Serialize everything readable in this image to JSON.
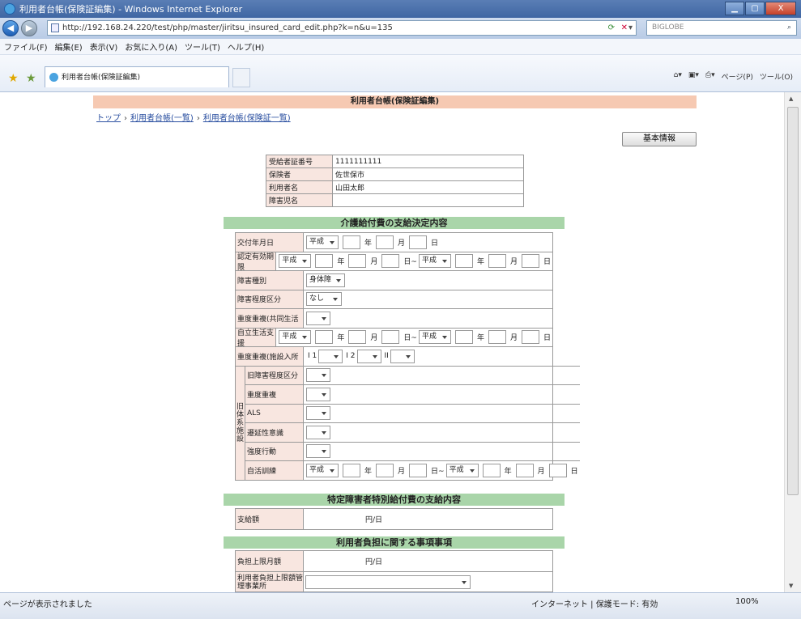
{
  "window": {
    "title": "利用者台帳(保険証編集) - Windows Internet Explorer",
    "btn_min": "▁",
    "btn_max": "▢",
    "btn_close": "X"
  },
  "address": {
    "url": "http://192.168.24.220/test/php/master/jiritsu_insured_card_edit.php?k=n&u=135",
    "search_placeholder": "BIGLOBE"
  },
  "menu": [
    "ファイル(F)",
    "編集(E)",
    "表示(V)",
    "お気に入り(A)",
    "ツール(T)",
    "ヘルプ(H)"
  ],
  "tab": {
    "label": "利用者台帳(保険証編集)"
  },
  "toolbar": {
    "page": "ページ(P)",
    "tools": "ツール(O)"
  },
  "page": {
    "header": "利用者台帳(保険証編集)",
    "breadcrumb": [
      {
        "label": "トップ"
      },
      {
        "label": "利用者台帳(一覧)"
      },
      {
        "label": "利用者台帳(保険証一覧)"
      }
    ],
    "breadcrumb_sep": "›",
    "basic_button": "基本情報",
    "info": [
      {
        "label": "受給者証番号",
        "value": "1111111111"
      },
      {
        "label": "保険者",
        "value": "佐世保市"
      },
      {
        "label": "利用者名",
        "value": "山田太郎"
      },
      {
        "label": "障害児名",
        "value": ""
      }
    ],
    "sec1_title": "介護給付費の支給決定内容",
    "era": "平成",
    "y": "年",
    "m": "月",
    "d": "日",
    "tilde": "日~",
    "rows": {
      "issue_date": "交付年月日",
      "valid_period": "認定有効期限",
      "disability_type": "障害種別",
      "disability_type_value": "身体障",
      "disability_level": "障害程度区分",
      "disability_level_value": "なし",
      "severe_group": "重度重複(共同生活",
      "independent": "自立生活支援",
      "severe_facility": "重度重複(施設入所",
      "i1": "I 1",
      "i2": "I 2",
      "ii": "II"
    },
    "old_group_label": "旧体系施設",
    "old_rows": [
      "旧障害程度区分",
      "重度重複",
      "ALS",
      "遷延性意識",
      "強度行動",
      "自活訓練"
    ],
    "sec2_title": "特定障害者特別給付費の支給内容",
    "payment_label": "支給額",
    "yen_per_day": "円/日",
    "sec3_title": "利用者負担に関する事項事項",
    "burden_label": "負担上限月額",
    "office_label": "利用者負担上限額管理事業所"
  },
  "status": {
    "left": "ページが表示されました",
    "zone": "インターネット | 保護モード: 有効",
    "zoom": "100%"
  }
}
